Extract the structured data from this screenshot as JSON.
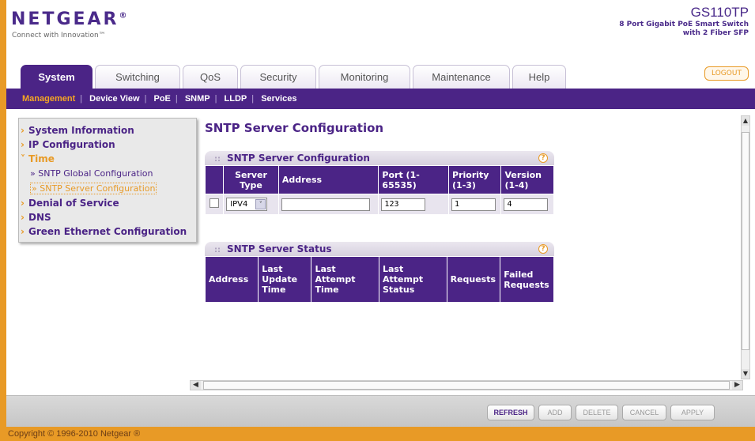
{
  "header": {
    "logo": "NETGEAR",
    "logo_mark": "®",
    "tagline": "Connect with Innovation™",
    "model": "GS110TP",
    "model_desc": "8 Port Gigabit PoE Smart Switch with 2 Fiber SFP"
  },
  "tabs": [
    {
      "label": "System",
      "active": true
    },
    {
      "label": "Switching"
    },
    {
      "label": "QoS"
    },
    {
      "label": "Security"
    },
    {
      "label": "Monitoring"
    },
    {
      "label": "Maintenance"
    },
    {
      "label": "Help"
    }
  ],
  "logout_label": "LOGOUT",
  "subnav": [
    {
      "label": "Management",
      "active": true
    },
    {
      "label": "Device View"
    },
    {
      "label": "PoE"
    },
    {
      "label": "SNMP"
    },
    {
      "label": "LLDP"
    },
    {
      "label": "Services"
    }
  ],
  "leftnav": {
    "system_information": "System Information",
    "ip_configuration": "IP Configuration",
    "time": "Time",
    "sntp_global": "» SNTP Global Configuration",
    "sntp_server": "» SNTP Server Configuration",
    "denial_of_service": "Denial of Service",
    "dns": "DNS",
    "green_ethernet": "Green Ethernet Configuration"
  },
  "page_title": "SNTP Server Configuration",
  "config_panel": {
    "title": "SNTP Server Configuration",
    "headers": {
      "server_type": "Server Type",
      "address": "Address",
      "port": "Port (1-65535)",
      "priority": "Priority (1-3)",
      "version": "Version (1-4)"
    },
    "row": {
      "server_type": "IPV4",
      "address": "",
      "port": "123",
      "priority": "1",
      "version": "4"
    }
  },
  "status_panel": {
    "title": "SNTP Server Status",
    "headers": {
      "address": "Address",
      "last_update_time": "Last Update Time",
      "last_attempt_time": "Last Attempt Time",
      "last_attempt_status": "Last Attempt Status",
      "requests": "Requests",
      "failed_requests": "Failed Requests"
    }
  },
  "actions": {
    "refresh": "REFRESH",
    "add": "ADD",
    "delete": "DELETE",
    "cancel": "CANCEL",
    "apply": "APPLY"
  },
  "copyright": "Copyright © 1996-2010 Netgear ®",
  "icons": {
    "help": "help-icon",
    "dropdown": "chevron-down-icon",
    "nav_arrow": "chevron-right-icon"
  },
  "colors": {
    "brand_purple": "#4b2486",
    "accent_orange": "#e89a26"
  }
}
